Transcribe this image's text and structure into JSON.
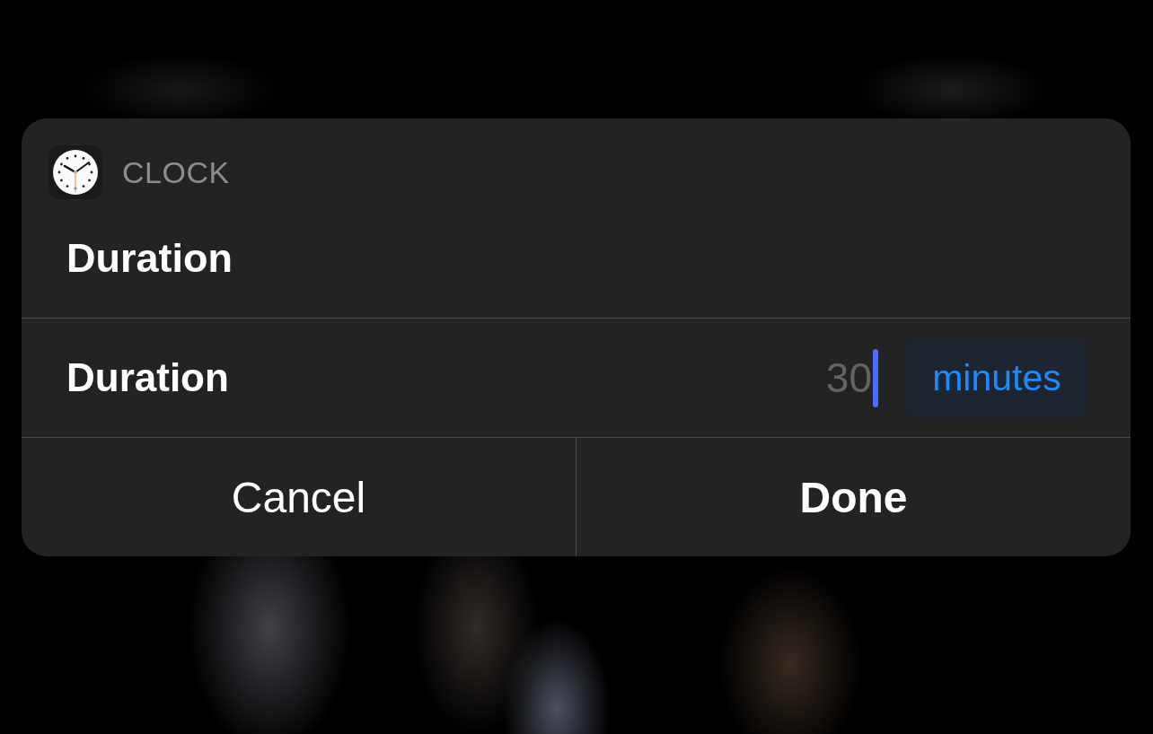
{
  "app": {
    "name": "CLOCK"
  },
  "title": "Duration",
  "field": {
    "label": "Duration",
    "placeholder": "30",
    "focused": true,
    "unit": "minutes"
  },
  "buttons": [
    {
      "label": "Cancel",
      "kind": "cancel"
    },
    {
      "label": "Done",
      "kind": "default"
    }
  ]
}
